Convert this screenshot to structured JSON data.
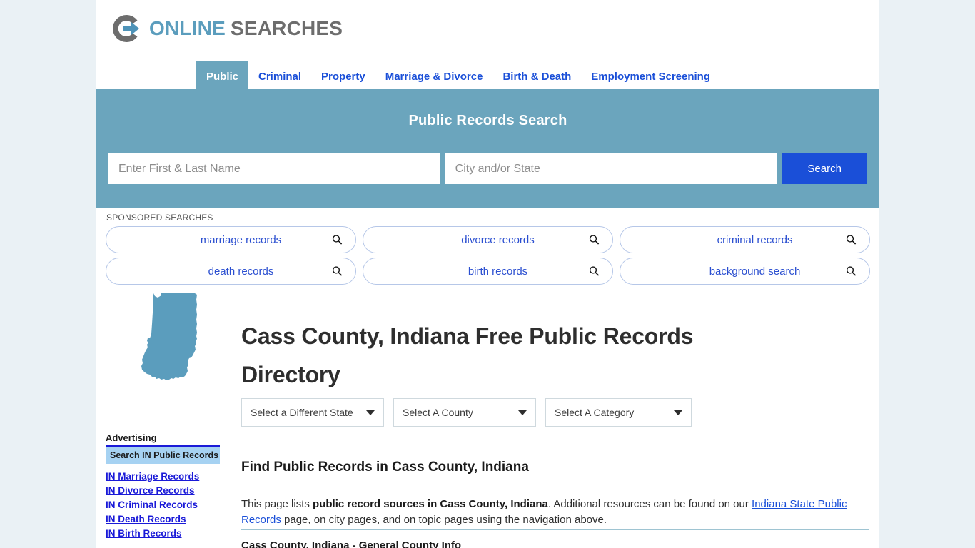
{
  "brand": {
    "logo_icon": "circle-arrow-logo-icon",
    "name_part1": "ONLINE",
    "name_part2": "SEARCHES",
    "colors": {
      "teal": "#6ba5bd",
      "link_blue": "#1a4fd8",
      "logo_grey": "#6d6d6d",
      "page_bg": "#eaf1f5",
      "ad_head_bg": "#a6d2f2"
    }
  },
  "nav": {
    "items": [
      {
        "label": "Public",
        "active": true
      },
      {
        "label": "Criminal",
        "active": false
      },
      {
        "label": "Property",
        "active": false
      },
      {
        "label": "Marriage & Divorce",
        "active": false
      },
      {
        "label": "Birth & Death",
        "active": false
      },
      {
        "label": "Employment Screening",
        "active": false
      }
    ]
  },
  "hero": {
    "title": "Public Records Search",
    "name_value": "",
    "name_placeholder": "Enter First & Last Name",
    "city_value": "",
    "city_placeholder": "City and/or State",
    "search_label": "Search"
  },
  "sponsored": {
    "label": "SPONSORED SEARCHES",
    "items": [
      {
        "label": "marriage records"
      },
      {
        "label": "divorce records"
      },
      {
        "label": "criminal records"
      },
      {
        "label": "death records"
      },
      {
        "label": "birth records"
      },
      {
        "label": "background search"
      }
    ]
  },
  "page": {
    "state_map_name": "indiana-state-map",
    "title": "Cass County, Indiana Free Public Records Directory"
  },
  "selects": {
    "state": "Select a Different State",
    "county": "Select A County",
    "category": "Select A Category"
  },
  "sidebar": {
    "ad_label": "Advertising",
    "ad_head": "Search IN Public Records",
    "links": [
      {
        "label": "IN Marriage Records"
      },
      {
        "label": "IN Divorce Records"
      },
      {
        "label": "IN Criminal Records"
      },
      {
        "label": "IN Death Records"
      },
      {
        "label": "IN Birth Records"
      }
    ]
  },
  "main": {
    "heading": "Find Public Records in Cass County, Indiana",
    "paragraph": {
      "part1": "This page lists ",
      "bold1": "public record sources in Cass County, Indiana",
      "part2": ". Additional resources can be found on our ",
      "link1": "Indiana State Public Records",
      "part3": " page, on city pages, and on topic pages using the navigation above."
    },
    "section_heading": "Cass County, Indiana - General County Info"
  }
}
